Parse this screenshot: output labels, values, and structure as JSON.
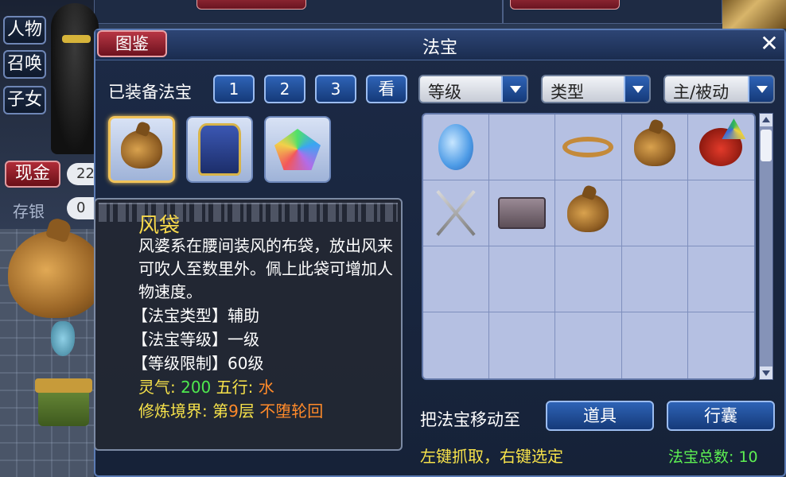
{
  "background": {
    "side_tabs": [
      "人物",
      "召唤",
      "子女"
    ],
    "gold_label": "现金",
    "gold_value": "22",
    "savings_label": "存银",
    "savings_value": "0"
  },
  "dialog": {
    "title": "法宝",
    "catalog_button": "图鉴",
    "close_glyph": "✕",
    "equipped_label": "已装备法宝",
    "page_buttons": [
      "1",
      "2",
      "3"
    ],
    "view_button": "看",
    "filters": [
      {
        "label": "等级"
      },
      {
        "label": "类型"
      },
      {
        "label": "主/被动"
      }
    ],
    "equipped_items": [
      {
        "icon": "wind-bag-icon",
        "selected": true
      },
      {
        "icon": "golden-armor-icon",
        "selected": false
      },
      {
        "icon": "rainbow-crystal-icon",
        "selected": false
      }
    ],
    "inventory": [
      {
        "icon": "blue-stone-icon"
      },
      {
        "icon": ""
      },
      {
        "icon": "rope-icon"
      },
      {
        "icon": "wind-bag-icon"
      },
      {
        "icon": "ladybug-umbrella-icon"
      },
      {
        "icon": "crossed-swords-icon"
      },
      {
        "icon": "treasure-box-icon"
      },
      {
        "icon": "wind-bag-icon"
      },
      {
        "icon": ""
      },
      {
        "icon": ""
      },
      {
        "icon": ""
      },
      {
        "icon": ""
      },
      {
        "icon": ""
      },
      {
        "icon": ""
      },
      {
        "icon": ""
      },
      {
        "icon": ""
      },
      {
        "icon": ""
      },
      {
        "icon": ""
      },
      {
        "icon": ""
      },
      {
        "icon": ""
      }
    ],
    "move_to_label": "把法宝移动至",
    "move_buttons": [
      "道具",
      "行囊"
    ],
    "hint": "左键抓取，右键选定",
    "total_label": "法宝总数: 10"
  },
  "tooltip": {
    "name": "风袋",
    "description": "风婆系在腰间装风的布袋，放出风来可吹人至数里外。佩上此袋可增加人物速度。",
    "type_line": "【法宝类型】辅助",
    "level_line": "【法宝等级】一级",
    "limit_line": "【等级限制】60级",
    "spirit_label": "灵气:",
    "spirit_value": "200",
    "element_label": "五行:",
    "element_value": "水",
    "realm_label": "修炼境界:",
    "realm_prefix": "第",
    "realm_layer": "9",
    "realm_suffix": "层",
    "realm_state": "不堕轮回"
  },
  "colors": {
    "accent_red": "#b73644",
    "accent_blue": "#2e63b6",
    "tooltip_yellow": "#f7e24a",
    "tooltip_green": "#4ee84e",
    "tooltip_orange": "#ff8a2a"
  }
}
